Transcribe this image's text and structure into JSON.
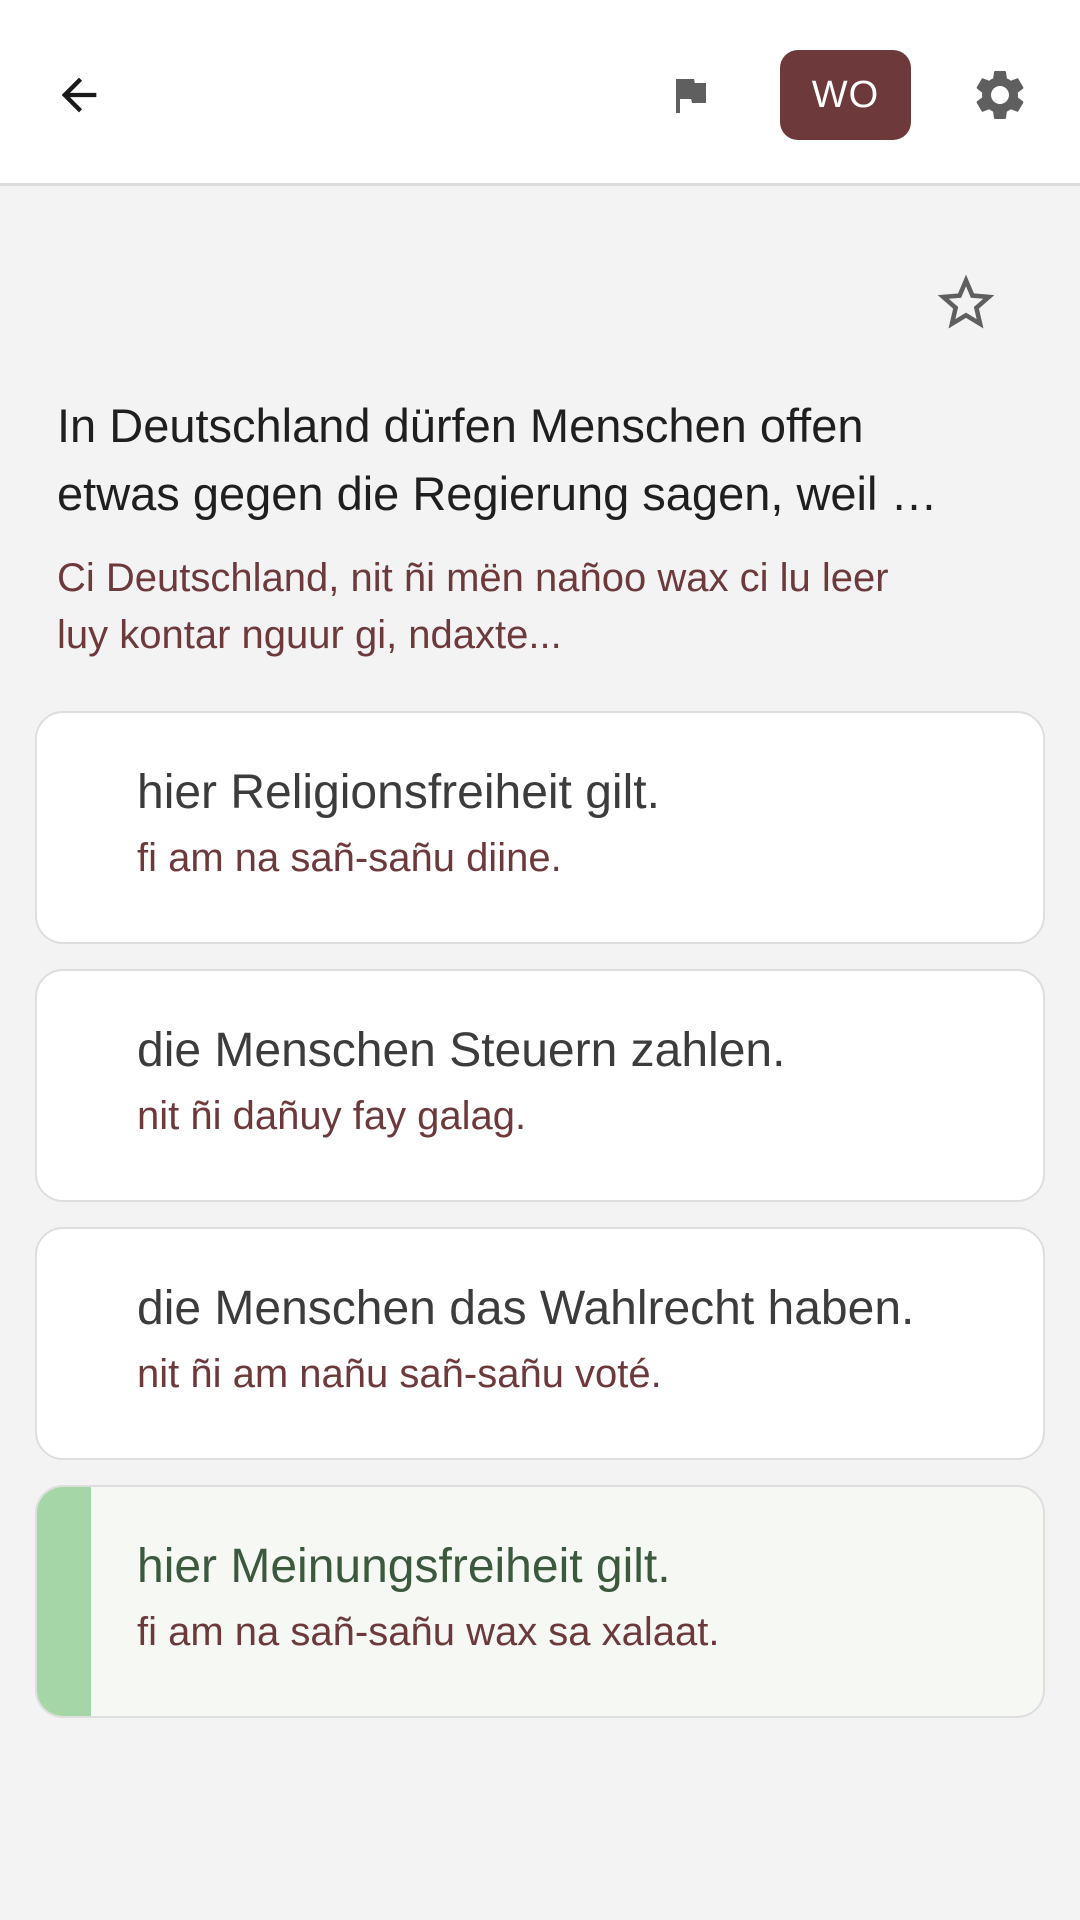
{
  "toolbar": {
    "icons": {
      "back": "arrow-back-icon",
      "flag": "flag-icon",
      "settings": "gear-icon",
      "star": "star-outline-icon"
    },
    "language_label": "WO",
    "language_button_color": "#6d393b"
  },
  "question": {
    "text": "In Deutschland dürfen Menschen offen\netwas gegen die Regierung sagen, weil …",
    "translation": "Ci Deutschland, nit ñi mën nañoo wax ci lu leer\nluy kontar nguur gi, ndaxte..."
  },
  "answers": [
    {
      "text": "hier Religionsfreiheit gilt.",
      "translation": "fi am na sañ-sañu diine.",
      "state": "default"
    },
    {
      "text": "die Menschen Steuern zahlen.",
      "translation": "nit ñi dañuy fay galag.",
      "state": "default"
    },
    {
      "text": "die Menschen das Wahlrecht haben.",
      "translation": "nit ñi am nañu sañ-sañu voté.",
      "state": "default"
    },
    {
      "text": "hier Meinungsfreiheit gilt.",
      "translation": "fi am na sañ-sañu wax sa xalaat.",
      "state": "correct"
    }
  ],
  "colors": {
    "translation_text": "#6d393b",
    "correct_accent": "#a5d6a7",
    "background": "#f3f3f3"
  }
}
